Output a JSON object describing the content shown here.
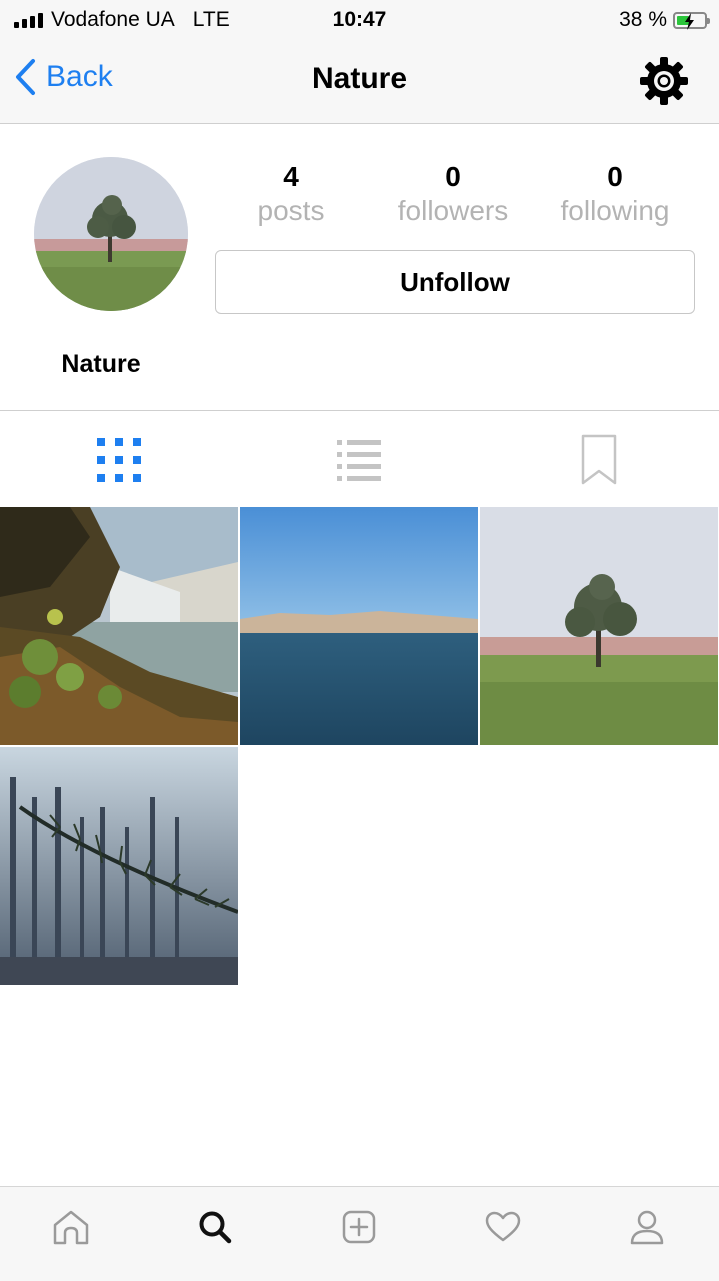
{
  "status_bar": {
    "carrier": "Vodafone UA",
    "network": "LTE",
    "time": "10:47",
    "battery": "38 %"
  },
  "nav": {
    "back_label": "Back",
    "title": "Nature"
  },
  "profile": {
    "name": "Nature",
    "stats": [
      {
        "value": "4",
        "label": "posts"
      },
      {
        "value": "0",
        "label": "followers"
      },
      {
        "value": "0",
        "label": "following"
      }
    ],
    "action_label": "Unfollow"
  },
  "view_tabs": [
    {
      "icon": "grid-icon",
      "active": true
    },
    {
      "icon": "list-icon",
      "active": false
    },
    {
      "icon": "bookmark-icon",
      "active": false
    }
  ],
  "posts": [
    "waterfall",
    "sea",
    "tree",
    "pine-forest"
  ],
  "tab_bar": [
    "home-icon",
    "search-icon",
    "add-post-icon",
    "heart-icon",
    "profile-icon"
  ],
  "colors": {
    "accent": "#1e7ff0",
    "battery": "#2bc53b"
  }
}
